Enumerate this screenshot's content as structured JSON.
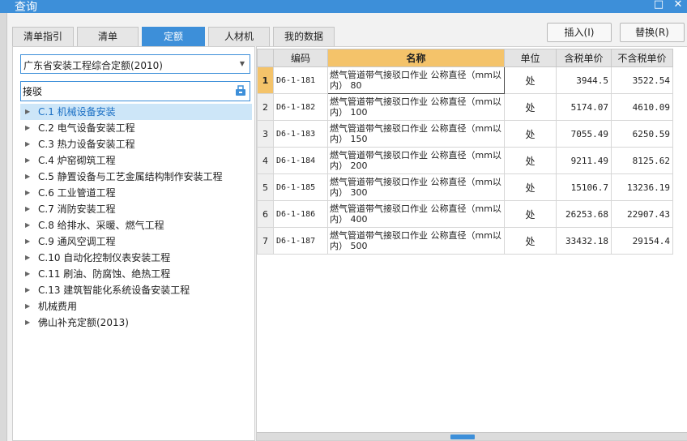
{
  "window": {
    "title": "查询",
    "maximize_icon": "maximize-icon",
    "close_icon": "close-icon"
  },
  "tabs": [
    {
      "label": "清单指引",
      "active": false
    },
    {
      "label": "清单",
      "active": false
    },
    {
      "label": "定额",
      "active": true
    },
    {
      "label": "人材机",
      "active": false
    },
    {
      "label": "我的数据",
      "active": false
    }
  ],
  "buttons": {
    "insert": "插入(I)",
    "replace": "替换(R)"
  },
  "library": {
    "selected": "广东省安装工程综合定额(2010)"
  },
  "search": {
    "value": "接驳",
    "icon": "search-icon"
  },
  "tree": [
    {
      "label": "C.1 机械设备安装",
      "selected": true
    },
    {
      "label": "C.2 电气设备安装工程",
      "selected": false
    },
    {
      "label": "C.3 热力设备安装工程",
      "selected": false
    },
    {
      "label": "C.4 炉窑砌筑工程",
      "selected": false
    },
    {
      "label": "C.5 静置设备与工艺金属结构制作安装工程",
      "selected": false
    },
    {
      "label": "C.6 工业管道工程",
      "selected": false
    },
    {
      "label": "C.7 消防安装工程",
      "selected": false
    },
    {
      "label": "C.8 给排水、采暖、燃气工程",
      "selected": false
    },
    {
      "label": "C.9 通风空调工程",
      "selected": false
    },
    {
      "label": "C.10 自动化控制仪表安装工程",
      "selected": false
    },
    {
      "label": "C.11 刷油、防腐蚀、绝热工程",
      "selected": false
    },
    {
      "label": "C.13 建筑智能化系统设备安装工程",
      "selected": false
    },
    {
      "label": "机械费用",
      "selected": false
    },
    {
      "label": "佛山补充定额(2013)",
      "selected": false
    }
  ],
  "table": {
    "headers": {
      "code": "编码",
      "name": "名称",
      "unit": "单位",
      "tax_price": "含税单价",
      "notax_price": "不含税单价"
    },
    "rows": [
      {
        "no": "1",
        "code": "D6-1-181",
        "name": "燃气管道带气接驳口作业 公称直径（mm以内） 80",
        "unit": "处",
        "tax_price": "3944.5",
        "notax_price": "3522.54"
      },
      {
        "no": "2",
        "code": "D6-1-182",
        "name": "燃气管道带气接驳口作业 公称直径（mm以内） 100",
        "unit": "处",
        "tax_price": "5174.07",
        "notax_price": "4610.09"
      },
      {
        "no": "3",
        "code": "D6-1-183",
        "name": "燃气管道带气接驳口作业 公称直径（mm以内） 150",
        "unit": "处",
        "tax_price": "7055.49",
        "notax_price": "6250.59"
      },
      {
        "no": "4",
        "code": "D6-1-184",
        "name": "燃气管道带气接驳口作业 公称直径（mm以内） 200",
        "unit": "处",
        "tax_price": "9211.49",
        "notax_price": "8125.62"
      },
      {
        "no": "5",
        "code": "D6-1-185",
        "name": "燃气管道带气接驳口作业 公称直径（mm以内） 300",
        "unit": "处",
        "tax_price": "15106.7",
        "notax_price": "13236.19"
      },
      {
        "no": "6",
        "code": "D6-1-186",
        "name": "燃气管道带气接驳口作业 公称直径（mm以内） 400",
        "unit": "处",
        "tax_price": "26253.68",
        "notax_price": "22907.43"
      },
      {
        "no": "7",
        "code": "D6-1-187",
        "name": "燃气管道带气接驳口作业 公称直径（mm以内） 500",
        "unit": "处",
        "tax_price": "33432.18",
        "notax_price": "29154.4"
      }
    ]
  },
  "colors": {
    "accent": "#3d8fd9",
    "header_highlight": "#f4c36a",
    "tree_selected_bg": "#cde6f8"
  }
}
